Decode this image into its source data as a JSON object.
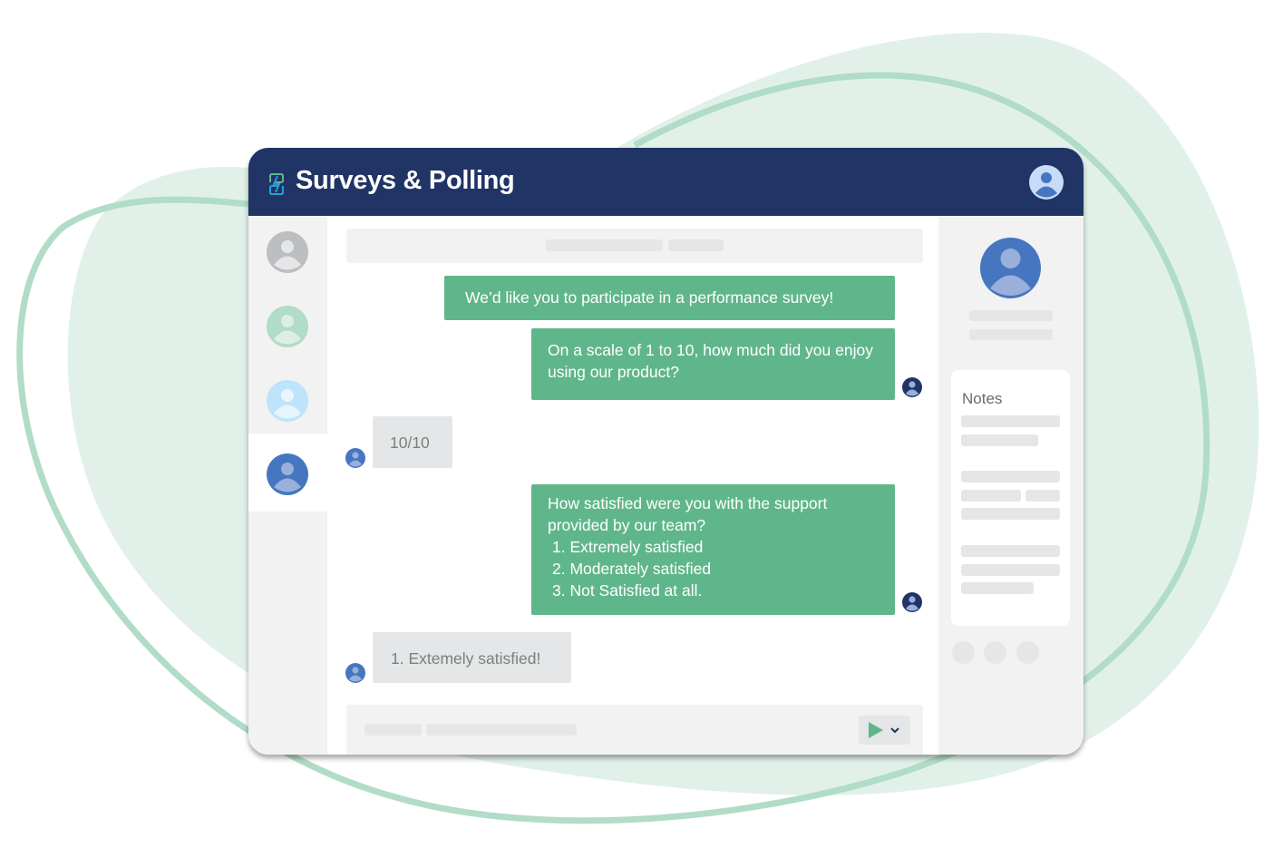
{
  "app": {
    "title": "Surveys & Polling",
    "logo_icon": "survey-chat-logo-icon",
    "user_icon": "user-avatar-icon"
  },
  "colors": {
    "header_bg": "#213466",
    "accent_green": "#60b68b",
    "incoming_bubble": "#e5e6e7",
    "panel_bg": "#f2f2f2",
    "blob_fill": "#e1f1e9",
    "blob_stroke": "#b1dcc7",
    "avatar_blue": "#4676bf",
    "avatar_dark": "#213466"
  },
  "sidebar": {
    "contacts": [
      {
        "name": "contact-gray",
        "color": "#bdbec0",
        "active": false
      },
      {
        "name": "contact-green",
        "color": "#b1dcc7",
        "active": false
      },
      {
        "name": "contact-lightblue",
        "color": "#bde4f9",
        "active": false
      },
      {
        "name": "contact-blue",
        "color": "#4676bf",
        "active": true
      }
    ]
  },
  "chat": {
    "messages": [
      {
        "direction": "outgoing",
        "text": "We’d like you to participate in a performance survey!"
      },
      {
        "direction": "outgoing",
        "text": "On a scale of 1 to 10, how much did you enjoy using our product?"
      },
      {
        "direction": "incoming",
        "text": "10/10"
      },
      {
        "direction": "outgoing",
        "text": "How satisfied were you with the support provided by our team?",
        "options": [
          "1. Extremely satisfied",
          "2. Moderately satisfied",
          "3. Not Satisfied at all."
        ]
      },
      {
        "direction": "incoming",
        "text": "1. Extemely satisfied!"
      }
    ],
    "composer": {
      "send_icon": "play-send-icon",
      "dropdown_icon": "chevron-down-icon"
    }
  },
  "right_panel": {
    "notes_title": "Notes"
  }
}
